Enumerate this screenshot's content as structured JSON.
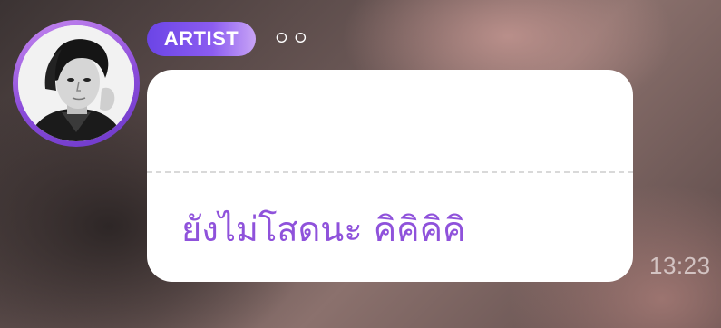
{
  "message": {
    "badge_label": "ARTIST",
    "sender_name": "০০",
    "quoted_text": "",
    "body": "ยังไม่โสดนะ คิคิคิคิ",
    "time": "13:23"
  },
  "colors": {
    "badge_gradient_start": "#6b45e6",
    "badge_gradient_end": "#c8a4f6",
    "avatar_ring": "#8a4bd9",
    "message_text": "#8f52db",
    "bubble_background": "#ffffff"
  },
  "icons": {
    "avatar": "artist-avatar-photo"
  }
}
